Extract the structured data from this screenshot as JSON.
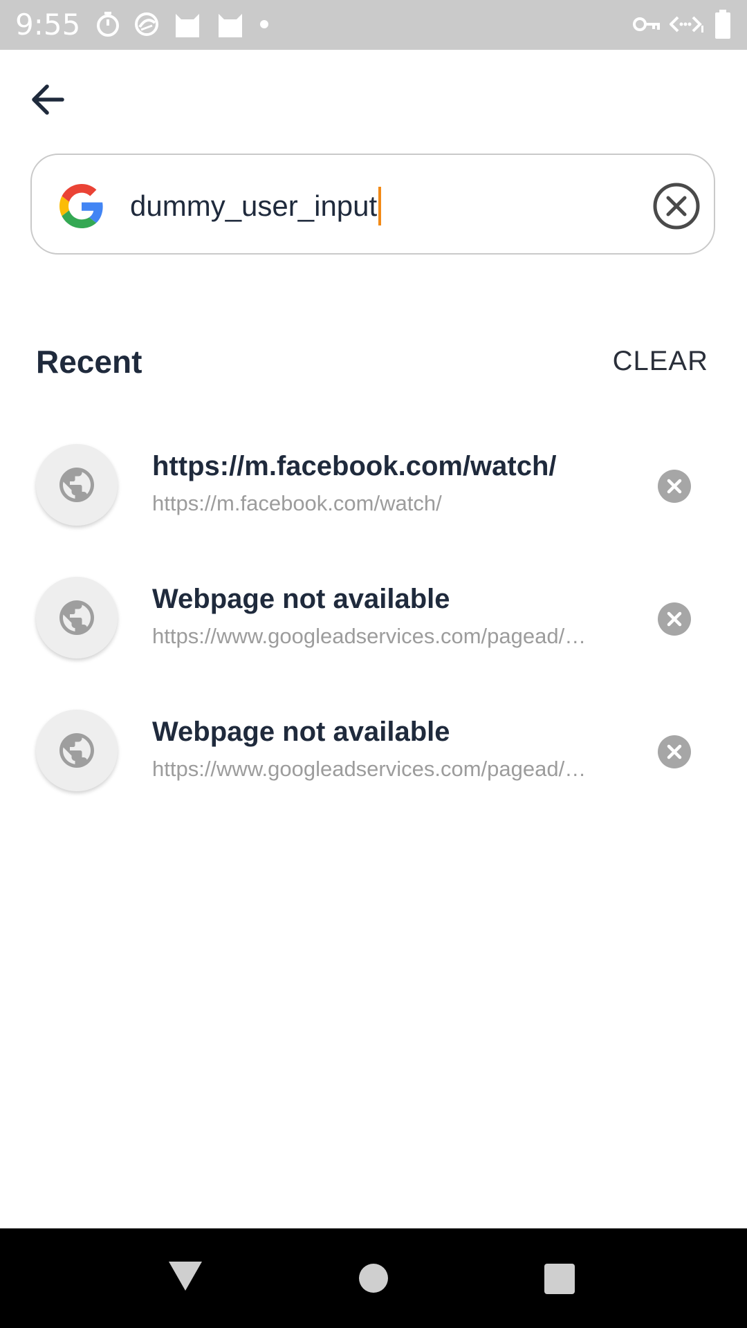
{
  "status_bar": {
    "time": "9:55",
    "left_icons": [
      "timer-icon",
      "sync-icon",
      "cat-icon",
      "cat-icon",
      "dot-icon"
    ],
    "right_icons": [
      "vpn-key-icon",
      "data-saver-icon",
      "battery-icon"
    ]
  },
  "header": {
    "back_icon": "arrow-left-icon"
  },
  "search": {
    "engine_icon": "google-g-icon",
    "value": "dummy_user_input",
    "clear_icon": "clear-circle-icon"
  },
  "recent": {
    "title": "Recent",
    "clear_label": "CLEAR",
    "items": [
      {
        "title": "https://m.facebook.com/watch/",
        "url": "https://m.facebook.com/watch/"
      },
      {
        "title": "Webpage not available",
        "url": "https://www.googleadservices.com/pagead/aclk"
      },
      {
        "title": "Webpage not available",
        "url": "https://www.googleadservices.com/pagead/aclk"
      }
    ]
  },
  "nav_bar": {
    "icons": [
      "back-triangle-icon",
      "home-circle-icon",
      "recents-square-icon"
    ]
  },
  "colors": {
    "text_dark": "#1f2a3c",
    "text_muted": "#9c9c9c",
    "caret": "#f28a17",
    "status_bar": "#cacaca"
  }
}
